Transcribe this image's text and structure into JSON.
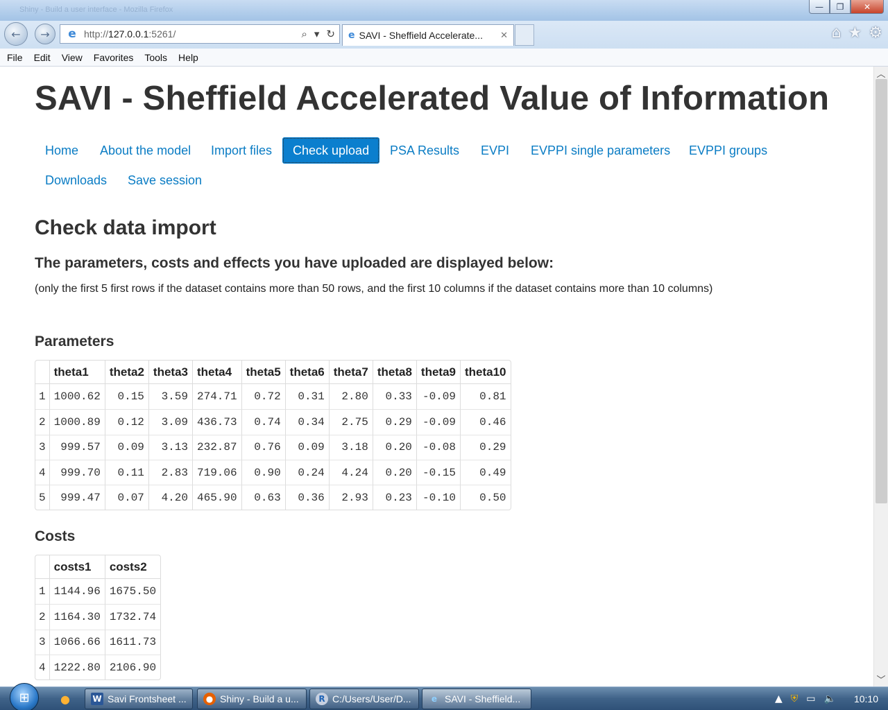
{
  "browser": {
    "ghost_title": "Shiny - Build a user interface - Mozilla Firefox",
    "window_buttons": [
      "—",
      "❐",
      "✕"
    ],
    "url_prefix": "http://",
    "url_host": "127.0.0.1",
    "url_port": ":5261/",
    "tab_title": "SAVI - Sheffield Accelerate...",
    "tab_close": "✕"
  },
  "menu": [
    "File",
    "Edit",
    "View",
    "Favorites",
    "Tools",
    "Help"
  ],
  "page": {
    "title": "SAVI - Sheffield Accelerated Value of Information",
    "tabs": [
      {
        "label": "Home",
        "active": false
      },
      {
        "label": "About the model",
        "active": false
      },
      {
        "label": "Import files",
        "active": false
      },
      {
        "label": "Check upload",
        "active": true
      },
      {
        "label": "PSA Results",
        "active": false
      },
      {
        "label": "EVPI",
        "active": false
      },
      {
        "label": "EVPPI single parameters",
        "active": false
      },
      {
        "label": "EVPPI groups",
        "active": false
      },
      {
        "label": "Downloads",
        "active": false
      },
      {
        "label": "Save session",
        "active": false
      }
    ],
    "section_title": "Check data import",
    "subtitle": "The parameters, costs and effects you have uploaded are displayed below:",
    "note": "(only the first 5 first rows if the dataset contains more than 50 rows, and the first 10 columns if the dataset contains more than 10 columns)",
    "parameters": {
      "title": "Parameters",
      "columns": [
        "",
        "theta1",
        "theta2",
        "theta3",
        "theta4",
        "theta5",
        "theta6",
        "theta7",
        "theta8",
        "theta9",
        "theta10"
      ],
      "rows": [
        [
          "1",
          "1000.62",
          "0.15",
          "3.59",
          "274.71",
          "0.72",
          "0.31",
          "2.80",
          "0.33",
          "-0.09",
          "0.81"
        ],
        [
          "2",
          "1000.89",
          "0.12",
          "3.09",
          "436.73",
          "0.74",
          "0.34",
          "2.75",
          "0.29",
          "-0.09",
          "0.46"
        ],
        [
          "3",
          "999.57",
          "0.09",
          "3.13",
          "232.87",
          "0.76",
          "0.09",
          "3.18",
          "0.20",
          "-0.08",
          "0.29"
        ],
        [
          "4",
          "999.70",
          "0.11",
          "2.83",
          "719.06",
          "0.90",
          "0.24",
          "4.24",
          "0.20",
          "-0.15",
          "0.49"
        ],
        [
          "5",
          "999.47",
          "0.07",
          "4.20",
          "465.90",
          "0.63",
          "0.36",
          "2.93",
          "0.23",
          "-0.10",
          "0.50"
        ]
      ]
    },
    "costs": {
      "title": "Costs",
      "columns": [
        "",
        "costs1",
        "costs2"
      ],
      "rows": [
        [
          "1",
          "1144.96",
          "1675.50"
        ],
        [
          "2",
          "1164.30",
          "1732.74"
        ],
        [
          "3",
          "1066.66",
          "1611.73"
        ],
        [
          "4",
          "1222.80",
          "2106.90"
        ]
      ]
    }
  },
  "taskbar": {
    "items": [
      {
        "label": "Savi Frontsheet ...",
        "icon": "word-icon",
        "active": false
      },
      {
        "label": "Shiny - Build a u...",
        "icon": "firefox-icon",
        "active": false
      },
      {
        "label": "C:/Users/User/D...",
        "icon": "r-icon",
        "active": false
      },
      {
        "label": "SAVI - Sheffield...",
        "icon": "ie-icon",
        "active": true
      }
    ],
    "clock": "10:10"
  },
  "colors": {
    "link": "#0a7cc4",
    "active_tab_bg": "#0b7fce",
    "heading_text": "#333333"
  }
}
